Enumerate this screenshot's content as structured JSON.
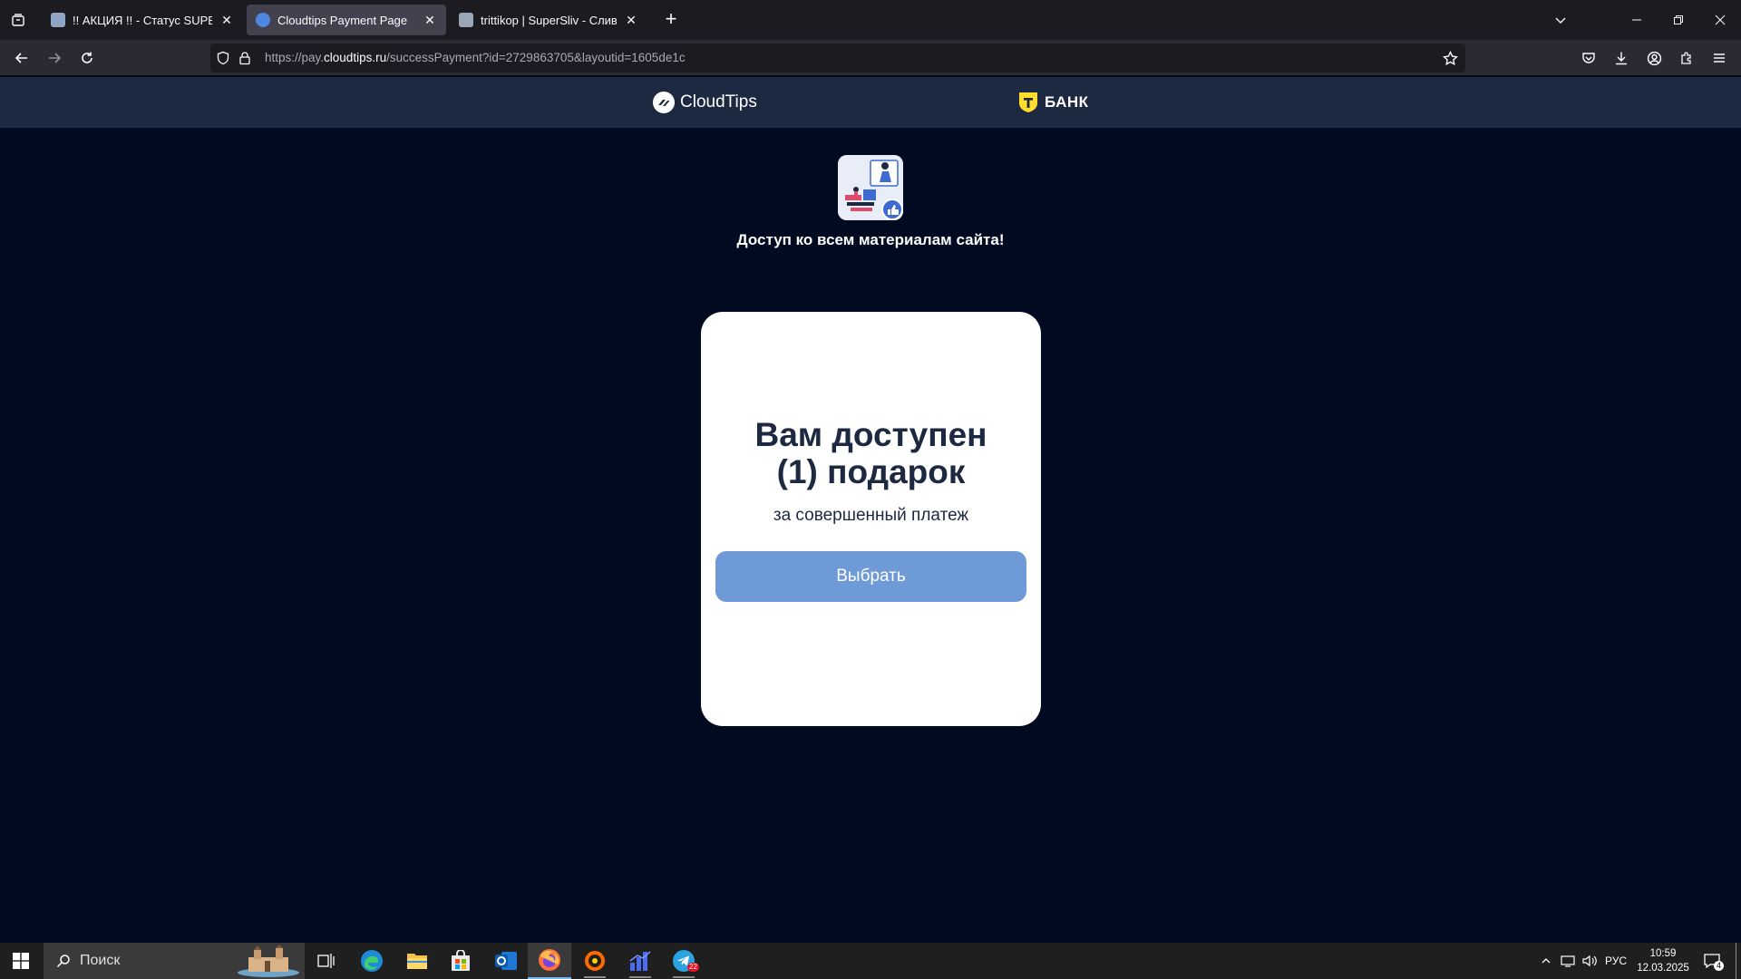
{
  "browser": {
    "tabs": [
      {
        "title": "!! АКЦИЯ !! - Статус SUPER VIP",
        "active": false
      },
      {
        "title": "Cloudtips Payment Page",
        "active": true
      },
      {
        "title": "trittikop | SuperSliv - Слив Платн",
        "active": false
      }
    ],
    "url": {
      "prefix": "https://pay.",
      "domain": "cloudtips.ru",
      "path": "/successPayment?id=2729863705&layoutid=1605de1c"
    }
  },
  "page": {
    "header": {
      "cloud_brand": "CloudTips",
      "bank_brand": "БАНК",
      "bank_logo_letter": "Т"
    },
    "product_title": "Доступ ко всем материалам сайта!",
    "card": {
      "heading_line1": "Вам доступен",
      "heading_line2": "(1) подарок",
      "subtitle": "за совершенный платеж",
      "button_label": "Выбрать"
    },
    "colors": {
      "page_bg": "#000b22",
      "header_bg": "#1d2941",
      "button_bg": "#6f9ad8",
      "heading": "#1d2941"
    }
  },
  "taskbar": {
    "search_placeholder": "Поиск",
    "language": "РУС",
    "time": "10:59",
    "date": "12.03.2025",
    "notifications_count": "4",
    "telegram_badge": "22"
  }
}
